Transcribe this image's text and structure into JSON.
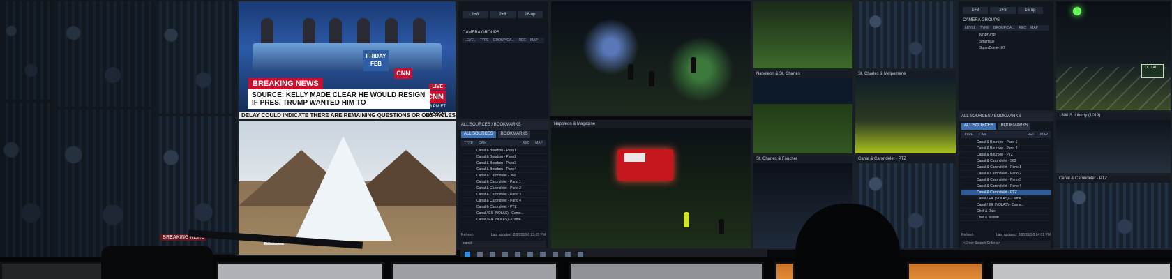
{
  "news": {
    "breaking_label": "BREAKING NEWS",
    "headline": "SOURCE: KELLY MADE CLEAR HE WOULD RESIGN IF PRES. TRUMP WANTED HIM TO",
    "ticker": "DELAY COULD INDICATE THERE ARE REMAINING QUESTIONS OR OBSTACLES",
    "live": "LIVE",
    "network": "CNN",
    "date_day": "FRIDAY",
    "date_month": "FEB",
    "time": "8:36 PM ET",
    "show": "AC360°"
  },
  "lower_left": {
    "watermark": "BREAKING NEWS",
    "caption": "KINNER"
  },
  "vms_top": {
    "layout_buttons": [
      "1+8",
      "2+8",
      "16-up"
    ],
    "camera_groups_label": "CAMERA GROUPS",
    "group_cols": [
      "LEVEL",
      "TYPE",
      "GROUP/CA...",
      "REC",
      "MAP"
    ]
  },
  "vms_top_right": {
    "layout_buttons": [
      "1+8",
      "2+8",
      "16-up"
    ],
    "camera_groups_label": "CAMERA GROUPS",
    "group_cols": [
      "LEVEL",
      "TYPE",
      "GROUP/CA...",
      "REC",
      "MAP"
    ],
    "groups": [
      "NOPD/DP",
      "Smartsue",
      "SuperDome-107"
    ]
  },
  "bookmark_left": {
    "header": "ALL SOURCES / BOOKMARKS",
    "tabs": [
      "ALL SOURCES",
      "BOOKMARKS"
    ],
    "cols": [
      "TYPE",
      "CAM",
      "REC",
      "MAP"
    ],
    "rows": [
      "Canal & Bourbon - Pano1",
      "Canal & Bourbon - Pano2",
      "Canal & Bourbon - Pano3",
      "Canal & Bourbon - Pano4",
      "Canal & Carondelet - 360",
      "Canal & Carondelet - Pano 1",
      "Canal & Carondelet - Pano 2",
      "Canal & Carondelet - Pano 3",
      "Canal & Carondelet - Pano 4",
      "Canal & Carondelet - PTZ",
      "Canal / Elk (NOLAS) - Came...",
      "Canal / Elk (NOLAS) - Came..."
    ],
    "refresh": "Refresh",
    "updated": "Last updated: 2/9/2018 8:23:05 PM",
    "search": "canal"
  },
  "bookmark_right": {
    "header": "ALL SOURCES / BOOKMARKS",
    "tabs": [
      "ALL SOURCES",
      "BOOKMARKS"
    ],
    "cols": [
      "TYPE",
      "CAM",
      "REC",
      "MAP"
    ],
    "rows": [
      "Canal & Bourbon - Pano 1",
      "Canal & Bourbon - Pano 3",
      "Canal & Bourbon - PTZ",
      "Canal & Carondelet - 360",
      "Canal & Carondelet - Pano 1",
      "Canal & Carondelet - Pano 2",
      "Canal & Carondelet - Pano 3",
      "Canal & Carondelet - Pano 4",
      "Canal & Carondelet - PTZ",
      "Canal / Elk (NOLAS) - Came...",
      "Canal / Elk (NOLAS) - Came...",
      "Chef & Dale",
      "Chef & Wilson"
    ],
    "selected_index": 8,
    "refresh": "Refresh",
    "updated": "Last updated: 2/9/2018 8:24:01 PM",
    "search": "<Enter Search Criteria>"
  },
  "camera_titles": {
    "napoleon_stcharles": "Napoleon & St. Charles",
    "stcharles_melpomene": "St. Charles & Melpomene",
    "napoleon_magazine": "Napoleon & Magazine",
    "stcharles_foucher": "St. Charles & Foucher",
    "canal_carondelet_ptz": "Canal & Carondelet - PTZ",
    "s_liberty": "1800 S. Liberty (1019)",
    "canal_carondelet_360": "Canal & Carondelet - PTZ"
  },
  "street_sign": "OLD AL..."
}
